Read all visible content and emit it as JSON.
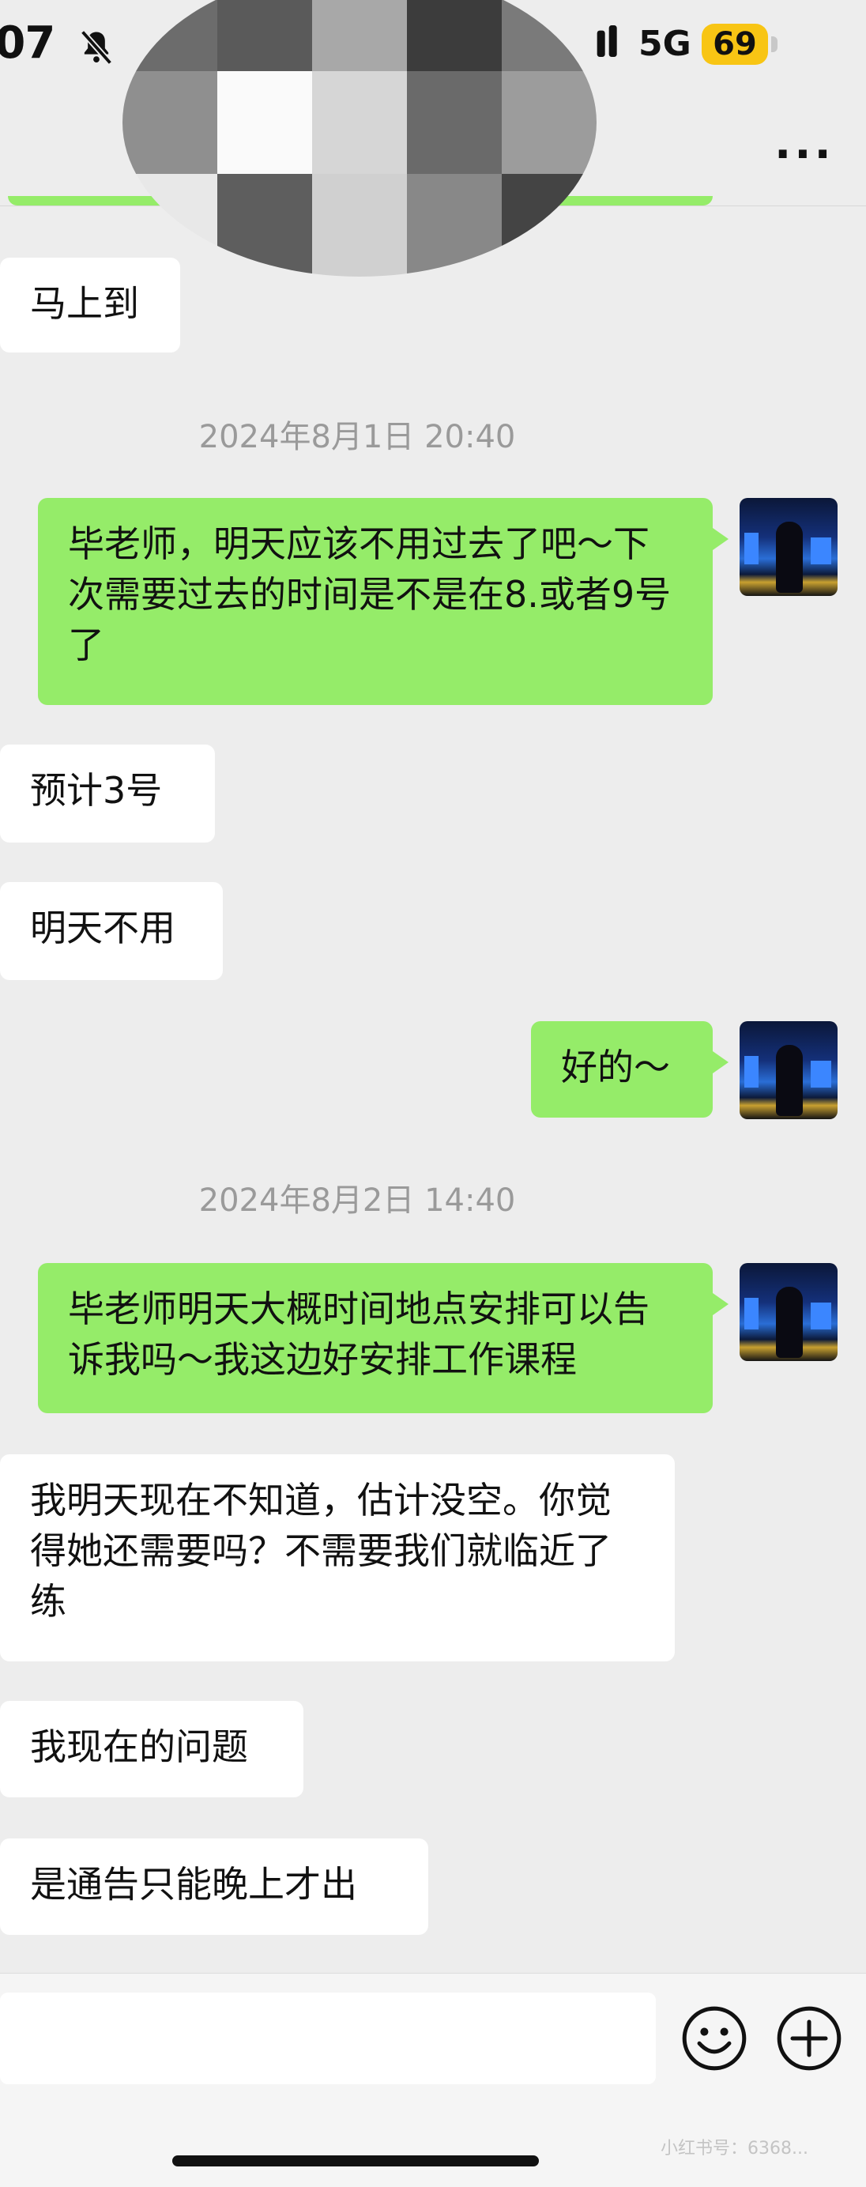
{
  "status_bar": {
    "time": ":07",
    "network": "5G",
    "battery": "69",
    "icons": [
      "bell-muted-icon",
      "signal-icon",
      "battery-icon"
    ]
  },
  "nav": {
    "more_label": "···"
  },
  "messages": [
    {
      "side": "in",
      "text": "马上到"
    },
    {
      "timestamp": "2024年8月1日 20:40"
    },
    {
      "side": "out",
      "text": "毕老师，明天应该不用过去了吧～下次需要过去的时间是不是在8.或者9号了"
    },
    {
      "side": "in",
      "text": "预计3号"
    },
    {
      "side": "in",
      "text": "明天不用"
    },
    {
      "side": "out",
      "text": "好的～"
    },
    {
      "timestamp": "2024年8月2日 14:40"
    },
    {
      "side": "out",
      "text": "毕老师明天大概时间地点安排可以告诉我吗～我这边好安排工作课程"
    },
    {
      "side": "in",
      "text": "我明天现在不知道，估计没空。你觉得她还需要吗？不需要我们就临近了练"
    },
    {
      "side": "in",
      "text": "我现在的问题"
    },
    {
      "side": "in",
      "text": "是通告只能晚上才出"
    }
  ],
  "input_bar": {
    "icons": [
      "emoji-icon",
      "plus-icon"
    ]
  },
  "watermark": "小红书号：6368...",
  "colors": {
    "outgoing_bubble": "#95ec69",
    "incoming_bubble": "#ffffff",
    "background": "#ededed",
    "battery": "#f8c514"
  }
}
